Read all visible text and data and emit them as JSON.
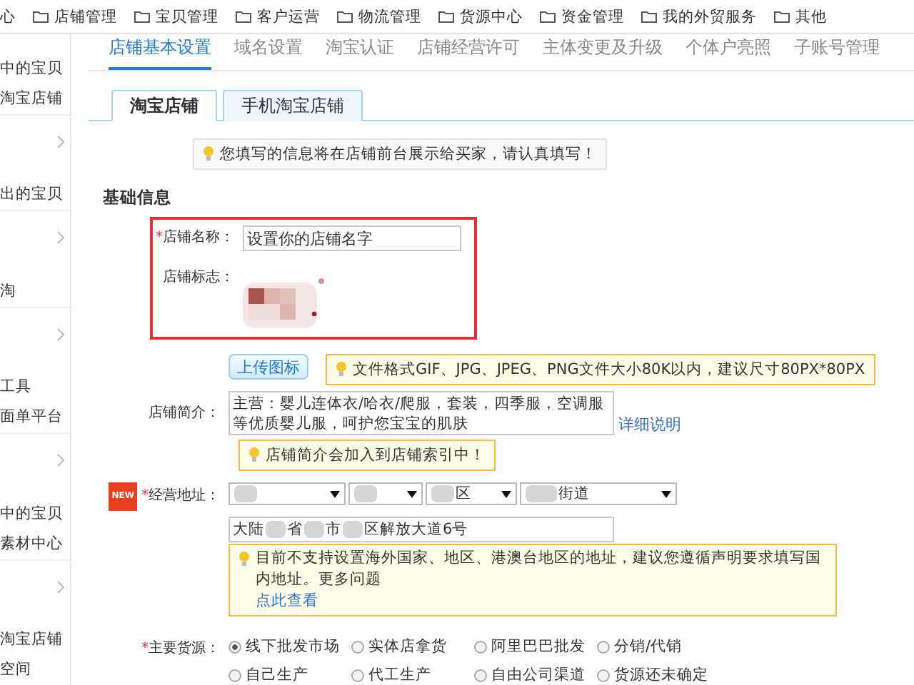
{
  "top_nav": [
    "心",
    "店铺管理",
    "宝贝管理",
    "客户运营",
    "物流管理",
    "货源中心",
    "资金管理",
    "我的外贸服务",
    "其他"
  ],
  "sidebar": [
    {
      "items": [
        "中的宝贝",
        "淘宝店铺"
      ]
    },
    {
      "items": [
        "出的宝贝"
      ]
    },
    {
      "items": [
        "淘"
      ]
    },
    {
      "items": [
        "工具",
        "面单平台"
      ]
    },
    {
      "items": [
        "中的宝贝",
        "素材中心"
      ]
    },
    {
      "items": [
        "淘宝店铺",
        "空间"
      ]
    }
  ],
  "tabs": [
    {
      "label": "店铺基本设置",
      "selected": true
    },
    {
      "label": "域名设置",
      "selected": false
    },
    {
      "label": "淘宝认证",
      "selected": false
    },
    {
      "label": "店铺经营许可",
      "selected": false
    },
    {
      "label": "主体变更及升级",
      "selected": false
    },
    {
      "label": "个体户亮照",
      "selected": false
    },
    {
      "label": "子账号管理",
      "selected": false
    }
  ],
  "sub_tabs": [
    {
      "label": "淘宝店铺",
      "selected": true
    },
    {
      "label": "手机淘宝店铺",
      "selected": false
    }
  ],
  "notice": "您填写的信息将在店铺前台展示给买家，请认真填写！",
  "section_title": "基础信息",
  "shop_name": {
    "label": "店铺名称：",
    "required_mark": "*",
    "value": "设置你的店铺名字"
  },
  "shop_logo": {
    "label": "店铺标志：",
    "kind": "picture"
  },
  "upload_button": "上传图标",
  "upload_hint": "文件格式GIF、JPG、JPEG、PNG文件大小80K以内，建议尺寸80PX*80PX",
  "intro": {
    "label": "店铺简介：",
    "value": "主营：婴儿连体衣/哈衣/爬服，套装，四季服，空调服等优质婴儿服，呵护您宝宝的肌肤",
    "link": "详细说明",
    "hint": "店铺简介会加入到店铺索引中！"
  },
  "address": {
    "badge": "NEW",
    "label": "经营地址：",
    "required_mark": "*",
    "selects": [
      {
        "blurred": true
      },
      {
        "blurred": true
      },
      {
        "blurred": true,
        "value": "区"
      },
      {
        "blurred": true,
        "value": "街道"
      }
    ],
    "parts": [
      "大陆",
      "省",
      "市",
      "区解放大道6号"
    ],
    "warning": "目前不支持设置海外国家、地区、港澳台地区的地址，建议您遵循声明要求填写国内地址。更多问题",
    "warning_link": "点此查看"
  },
  "source": {
    "label": "主要货源：",
    "required_mark": "*",
    "options": [
      {
        "label": "线下批发市场",
        "selected": true
      },
      {
        "label": "实体店拿货",
        "selected": false
      },
      {
        "label": "阿里巴巴批发",
        "selected": false
      },
      {
        "label": "分销/代销",
        "selected": false
      },
      {
        "label": "自己生产",
        "selected": false
      },
      {
        "label": "代工生产",
        "selected": false
      },
      {
        "label": "自由公司渠道",
        "selected": false
      },
      {
        "label": "货源还未确定",
        "selected": false
      }
    ]
  }
}
